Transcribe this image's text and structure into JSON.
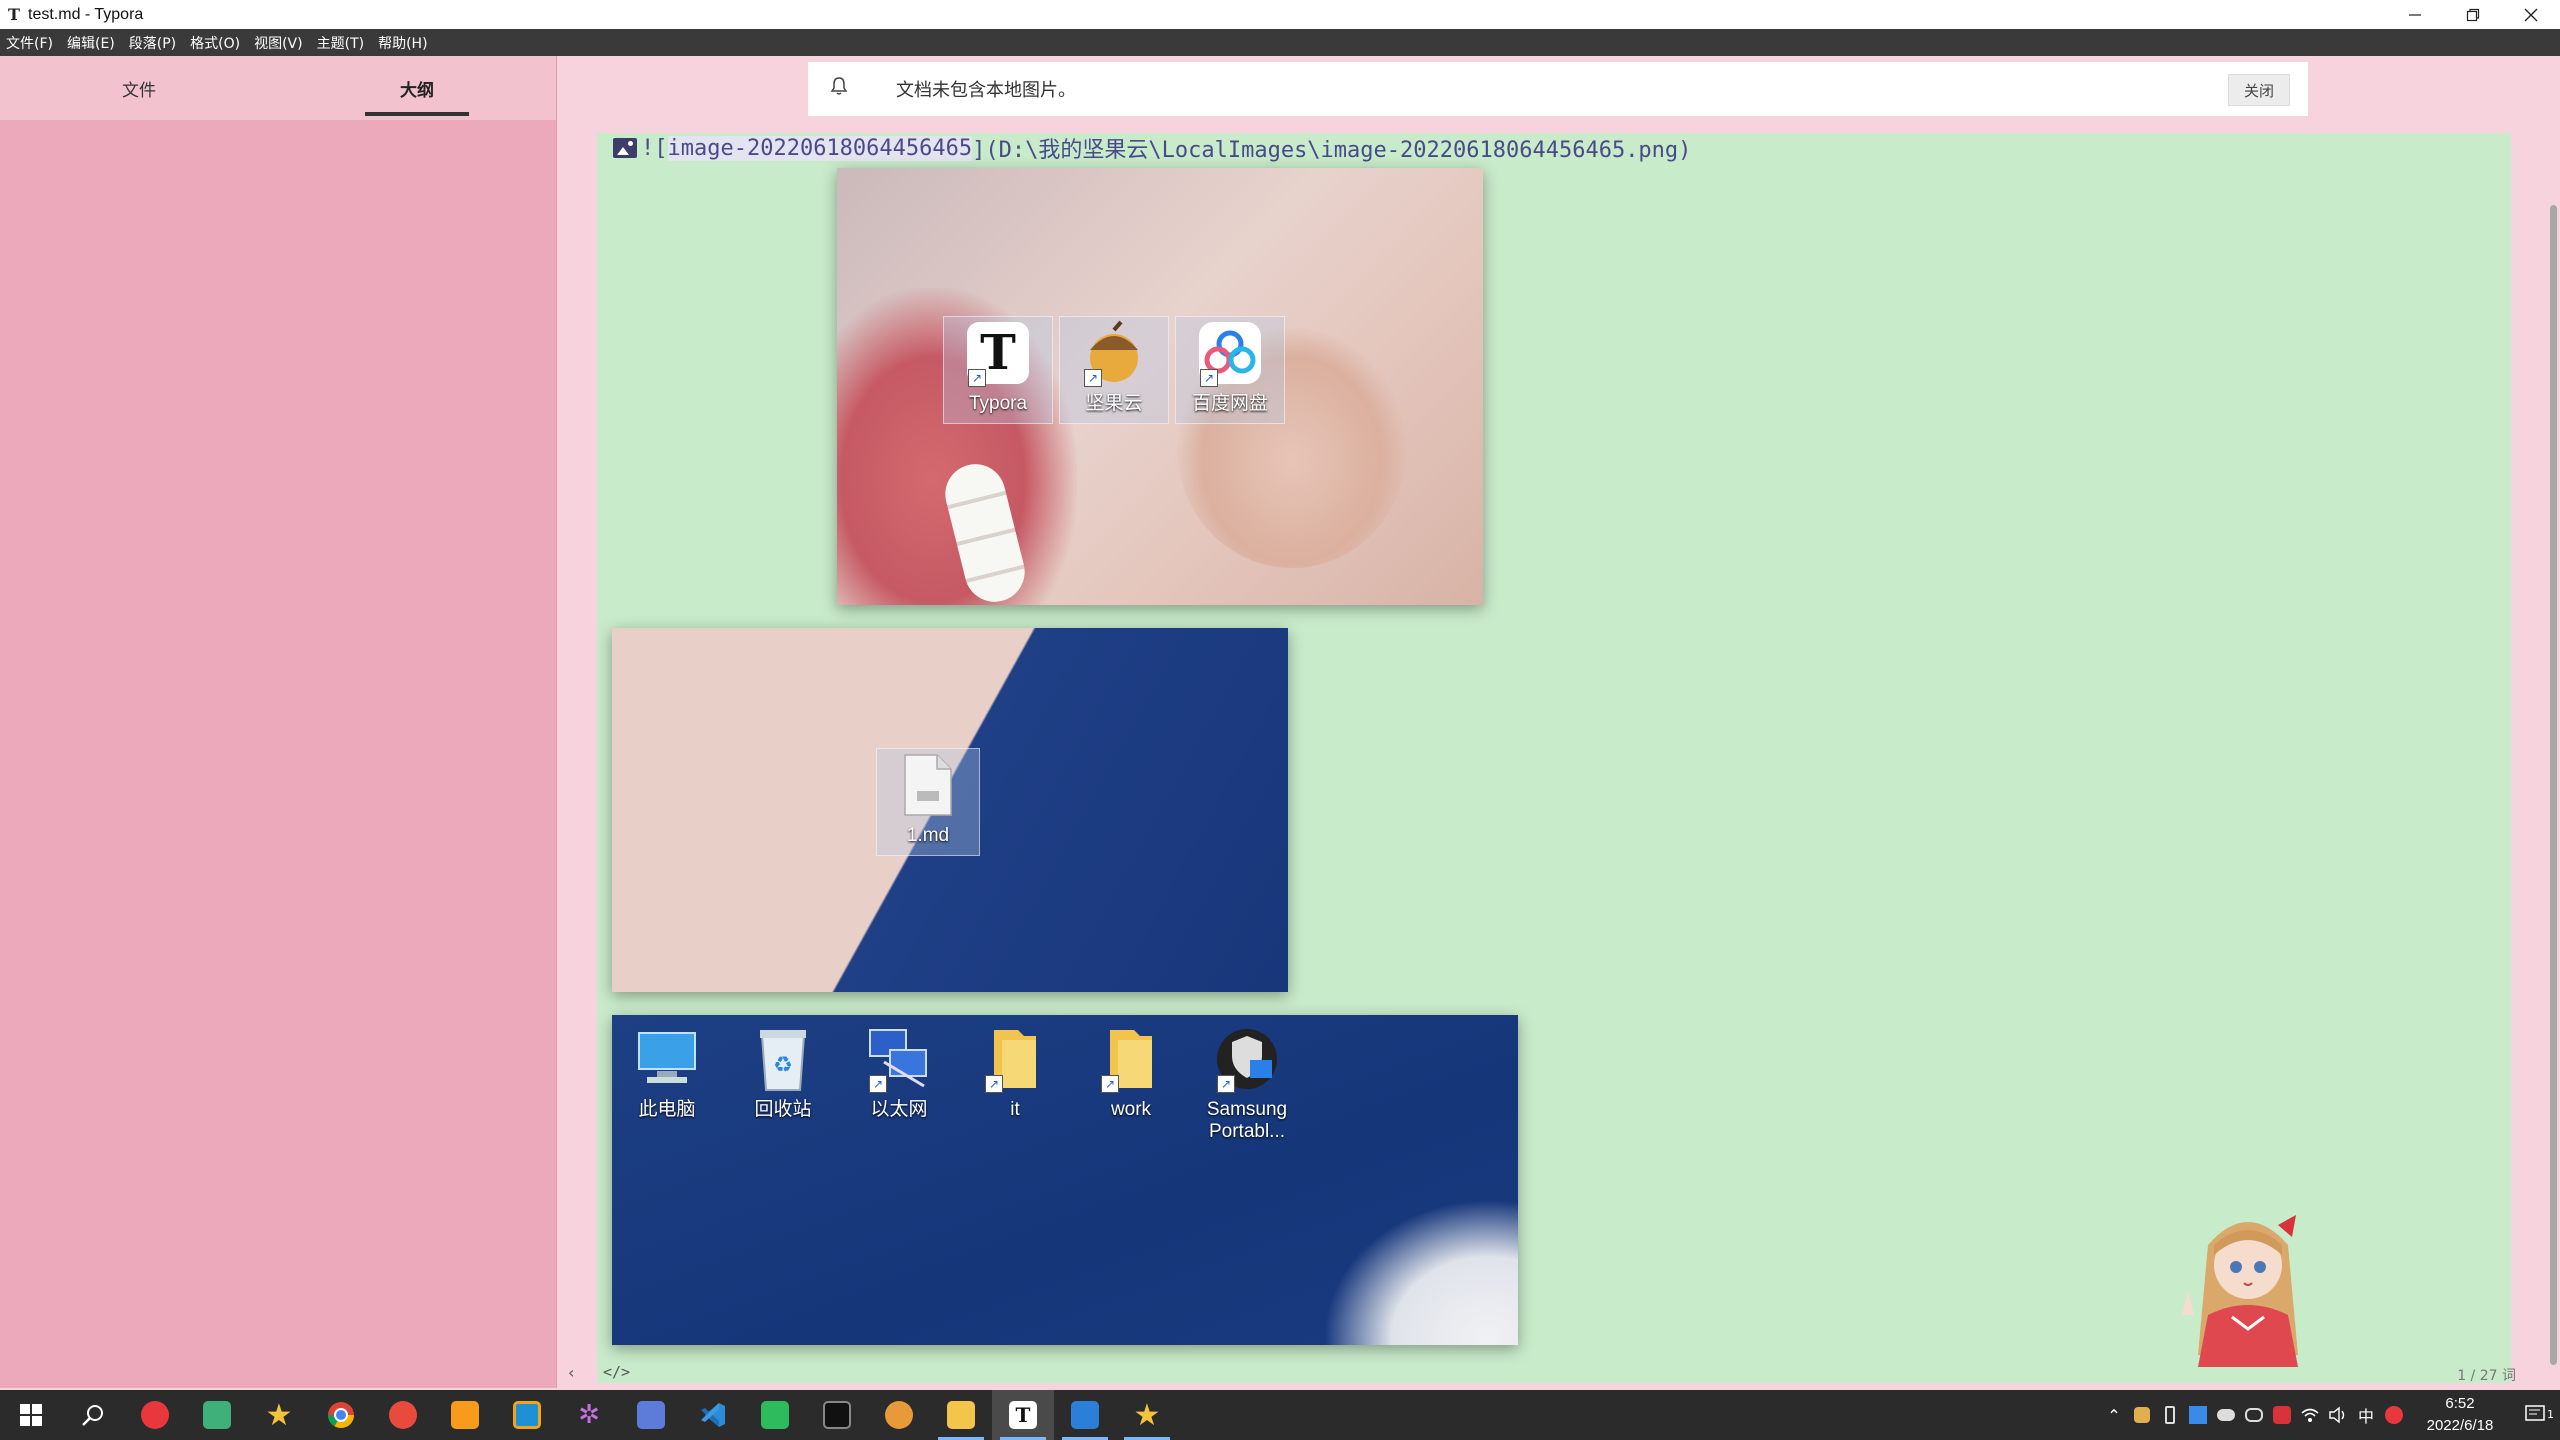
{
  "window": {
    "app_icon": "T",
    "title": "test.md - Typora",
    "minimize_icon": "minimize-icon",
    "restore_icon": "restore-icon",
    "close_icon": "close-icon"
  },
  "menu": {
    "items": [
      "文件(F)",
      "编辑(E)",
      "段落(P)",
      "格式(O)",
      "视图(V)",
      "主题(T)",
      "帮助(H)"
    ]
  },
  "sidebar": {
    "tabs": [
      {
        "label": "文件",
        "active": false
      },
      {
        "label": "大纲",
        "active": true
      }
    ]
  },
  "notice": {
    "icon": "bell-icon",
    "message": "文档未包含本地图片。",
    "close_label": "关闭"
  },
  "editor": {
    "source_prefix": "![",
    "source_alt": "image-20220618064456465",
    "source_rest": "](D:\\我的坚果云\\LocalImages\\image-20220618064456465.png)",
    "shot1_icons": [
      {
        "label": "Typora",
        "icon": "typora-icon"
      },
      {
        "label": "坚果云",
        "icon": "nutstore-icon"
      },
      {
        "label": "百度网盘",
        "icon": "baidu-netdisk-icon"
      }
    ],
    "shot2_icons": [
      {
        "label": "1.md",
        "icon": "markdown-file-icon"
      }
    ],
    "shot3_icons": [
      {
        "label": "此电脑",
        "icon": "this-pc-icon"
      },
      {
        "label": "回收站",
        "icon": "recycle-bin-icon"
      },
      {
        "label": "以太网",
        "icon": "ethernet-icon"
      },
      {
        "label": "it",
        "icon": "folder-icon"
      },
      {
        "label": "work",
        "icon": "folder-icon"
      },
      {
        "label": "Samsung\nPortabl...",
        "icon": "samsung-portable-ssd-icon"
      }
    ]
  },
  "status": {
    "left_arrow": "‹",
    "source_toggle": "</>",
    "word_count": "1 / 27 词"
  },
  "taskbar": {
    "apps": [
      {
        "name": "start-icon",
        "color": "#ffffff",
        "open": false
      },
      {
        "name": "search-icon",
        "color": "#ffffff",
        "open": false
      },
      {
        "name": "app-red-swirl-icon",
        "color": "#e8383d",
        "open": false
      },
      {
        "name": "app-green-s-icon",
        "color": "#3fb07a",
        "open": false
      },
      {
        "name": "app-star-icon",
        "color": "#f3c33a",
        "open": false
      },
      {
        "name": "chrome-icon",
        "color": "#4f8ef7",
        "open": false
      },
      {
        "name": "app-snail-icon",
        "color": "#e84a3d",
        "open": false
      },
      {
        "name": "sublime-icon",
        "color": "#f89a1c",
        "open": false
      },
      {
        "name": "app-orange-window-icon",
        "color": "#1e90d6",
        "open": false
      },
      {
        "name": "app-colorful-dots-icon",
        "color": "#9b59b6",
        "open": false
      },
      {
        "name": "app-pc-manager-icon",
        "color": "#5d7bd8",
        "open": false
      },
      {
        "name": "vscode-icon",
        "color": "#2f8ad8",
        "open": false
      },
      {
        "name": "app-green-doc-icon",
        "color": "#2dbb5d",
        "open": false
      },
      {
        "name": "terminal-icon",
        "color": "#1c1c1c",
        "open": false
      },
      {
        "name": "nutstore-icon",
        "color": "#e89a3a",
        "open": false
      },
      {
        "name": "file-explorer-icon",
        "color": "#f3c54a",
        "open": true
      },
      {
        "name": "typora-icon",
        "color": "#ffffff",
        "open": true,
        "active": true
      },
      {
        "name": "app-blue-paint-icon",
        "color": "#2c7fd8",
        "open": true
      },
      {
        "name": "app-star-yellow-icon",
        "color": "#f3c33a",
        "open": true
      }
    ]
  },
  "tray": {
    "icons": [
      "chevron-up-icon",
      "tray-cat-icon",
      "tray-usb-icon",
      "tray-blue-icon",
      "tray-cloud-icon",
      "tray-game-icon",
      "tray-red-icon",
      "wifi-icon",
      "volume-icon"
    ],
    "ime": "中",
    "ime_icon": "sogou-icon",
    "time": "6:52",
    "date": "2022/6/18",
    "notification_count": "1"
  }
}
